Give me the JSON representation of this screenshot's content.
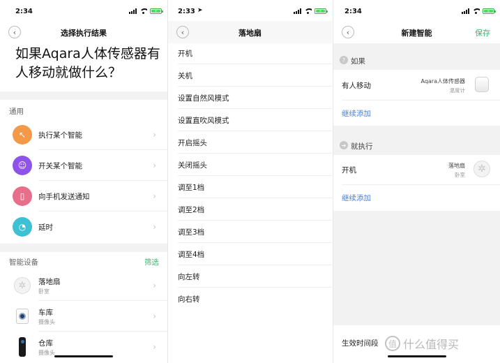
{
  "screen1": {
    "time": "2:34",
    "title": "选择执行结果",
    "question": "如果Aqara人体传感器有人移动就做什么？",
    "general_label": "通用",
    "general_items": [
      {
        "label": "执行某个智能",
        "icon": "cursor-icon",
        "color": "#f2994a"
      },
      {
        "label": "开关某个智能",
        "icon": "robot-icon",
        "color": "#8e54e9"
      },
      {
        "label": "向手机发送通知",
        "icon": "phone-icon",
        "color": "#e86f8b"
      },
      {
        "label": "延时",
        "icon": "clock-icon",
        "color": "#3fc1d4"
      }
    ],
    "devices_label": "智能设备",
    "filter_label": "筛选",
    "devices": [
      {
        "name": "落地扇",
        "room": "卧室",
        "icon": "fan-icon"
      },
      {
        "name": "车库",
        "room": "摄像头",
        "icon": "camera-icon"
      },
      {
        "name": "仓库",
        "room": "摄像头",
        "icon": "camera-icon"
      }
    ]
  },
  "screen2": {
    "time": "2:33",
    "title": "落地扇",
    "actions": [
      "开机",
      "关机",
      "设置自然风模式",
      "设置直吹风模式",
      "开启摇头",
      "关闭摇头",
      "调至1档",
      "调至2档",
      "调至3档",
      "调至4档",
      "向左转",
      "向右转"
    ]
  },
  "screen3": {
    "time": "2:34",
    "title": "新建智能",
    "save_label": "保存",
    "if_label": "如果",
    "condition": {
      "label": "有人移动",
      "device": "Aqara人体传感器",
      "device_type": "温度计"
    },
    "add_more": "继续添加",
    "then_label": "就执行",
    "action": {
      "label": "开机",
      "device": "落地扇",
      "room": "卧室"
    },
    "add_more_2": "继续添加",
    "effective_time_label": "生效时间段"
  },
  "watermark": {
    "text": "什么值得买",
    "logo_char": "值"
  }
}
